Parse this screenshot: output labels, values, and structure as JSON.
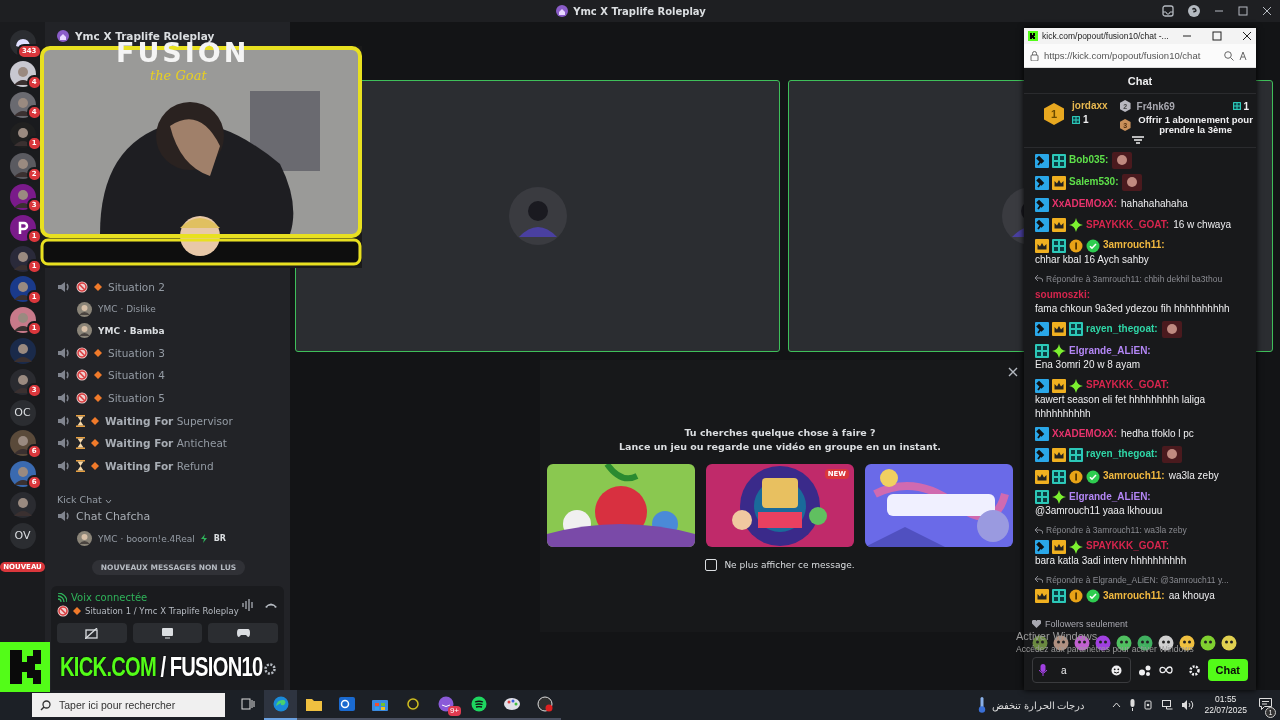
{
  "window": {
    "title": "Ymc X Traplife Roleplay"
  },
  "servers": [
    {
      "kind": "logo",
      "badge": "343"
    },
    {
      "kind": "avatar",
      "badge": "4"
    },
    {
      "kind": "avatar",
      "badge": "4"
    },
    {
      "kind": "avatar",
      "badge": "1"
    },
    {
      "kind": "avatar",
      "badge": "2"
    },
    {
      "kind": "avatar",
      "badge": "3"
    },
    {
      "kind": "letter",
      "badge": "1"
    },
    {
      "kind": "avatar",
      "badge": "1"
    },
    {
      "kind": "avatar",
      "badge": "1"
    },
    {
      "kind": "avatar",
      "badge": "1"
    },
    {
      "kind": "avatar"
    },
    {
      "kind": "avatar",
      "badge": "3"
    },
    {
      "kind": "initials",
      "label": "OC"
    },
    {
      "kind": "avatar",
      "badge": "6"
    },
    {
      "kind": "avatar",
      "badge": "6"
    },
    {
      "kind": "avatar"
    },
    {
      "kind": "initials",
      "label": "OV"
    }
  ],
  "new_pill": "NOUVEAU",
  "server_header": {
    "title": "Ymc X Traplife Roleplay"
  },
  "webcam_frame": {
    "logo": "FUSION",
    "tagline": "the Goat"
  },
  "channels": [
    {
      "kind": "voice",
      "blocked": true,
      "waiting": false,
      "name": "Situation 2",
      "members": [
        {
          "name": "YMC · Dislike",
          "speaking": false
        },
        {
          "name": "YMC · Bamba",
          "speaking": true
        }
      ]
    },
    {
      "kind": "voice",
      "blocked": true,
      "waiting": false,
      "name": "Situation 3"
    },
    {
      "kind": "voice",
      "blocked": true,
      "waiting": false,
      "name": "Situation 4"
    },
    {
      "kind": "voice",
      "blocked": true,
      "waiting": false,
      "name": "Situation 5"
    },
    {
      "kind": "voice",
      "blocked": false,
      "waiting": true,
      "name": "**Waiting For** Supervisor"
    },
    {
      "kind": "voice",
      "blocked": false,
      "waiting": true,
      "name": "**Waiting For** Anticheat"
    },
    {
      "kind": "voice",
      "blocked": false,
      "waiting": true,
      "name": "**Waiting For** Refund"
    },
    {
      "kind": "category",
      "name": "Kick Chat"
    },
    {
      "kind": "voice",
      "blocked": false,
      "waiting": false,
      "name": "Chat Chafcha",
      "members": [
        {
          "name": "YMC · booorn!e.4Real",
          "speaking": false,
          "badge": "BR"
        }
      ]
    }
  ],
  "unread_banner": "NOUVEAUX MESSAGES NON LUS",
  "voice": {
    "status": "Voix connectée",
    "channel": "Situation 1 / Ymc X Traplife Roleplay"
  },
  "stream_overlay": {
    "site": "KICK.COM",
    "separator": "/",
    "channel": "FUSION10"
  },
  "tiles": [
    {
      "speaking": true
    },
    {
      "speaking": true
    }
  ],
  "activity": {
    "title": "Tu cherches quelque chose à faire ?",
    "subtitle": "Lance un jeu ou regarde une vidéo en groupe en un instant.",
    "games": [
      {
        "kind": "picture"
      },
      {
        "kind": "picture",
        "badge": "NEW"
      },
      {
        "kind": "picture"
      }
    ],
    "dont_show": {
      "label": "Ne plus afficher ce message.",
      "checked": false
    }
  },
  "chat_window": {
    "title": "kick.com/popout/fusion10/chat -...",
    "url": "https://kick.com/popout/fusion10/chat",
    "heading": "Chat",
    "leaders": [
      {
        "rank": "1",
        "name": "jordaxx",
        "count": "1"
      },
      {
        "rank": "2",
        "name": "Fr4nk69",
        "count": "1"
      },
      {
        "rank": "3"
      }
    ],
    "gift_prompt": "Offrir 1 abonnement pour prendre la 3ème",
    "messages": [
      {
        "badges": [
          {
            "kind": "mod"
          },
          {
            "kind": "sub"
          }
        ],
        "user": "Bob035:",
        "color": "#5ee04a",
        "emote": true
      },
      {
        "badges": [
          {
            "kind": "mod"
          },
          {
            "kind": "crown"
          }
        ],
        "user": "Salem530:",
        "color": "#5ee04a",
        "emote": true
      },
      {
        "badges": [
          {
            "kind": "mod"
          }
        ],
        "user": "XxADEMOxX:",
        "color": "#e8336d",
        "text": "hahahahahaha"
      },
      {
        "badges": [
          {
            "kind": "mod"
          },
          {
            "kind": "crown"
          },
          {
            "kind": "sparkle"
          }
        ],
        "user": "SPAYKKK_GOAT:",
        "color": "#d6254d",
        "text": "16 w chwaya"
      },
      {
        "badges": [
          {
            "kind": "crown"
          },
          {
            "kind": "sub"
          },
          {
            "kind": "one"
          },
          {
            "kind": "verified"
          }
        ],
        "user": "3amrouch11:",
        "color": "#f0b840",
        "text": "chhar kbal 16 Aych sahby"
      },
      {
        "reply": "Répondre à 3amrouch11: chbih dekhil ba3thou",
        "user": "soumoszki:",
        "color": "#d6254d",
        "text": "fama chkoun 9a3ed ydezou fih hhhhhhhhhh"
      },
      {
        "badges": [
          {
            "kind": "mod"
          },
          {
            "kind": "crown"
          },
          {
            "kind": "sub"
          }
        ],
        "user": "rayen_thegoat:",
        "color": "#2fd6a7",
        "emote": true
      },
      {
        "badges": [
          {
            "kind": "sub"
          },
          {
            "kind": "sparkle"
          }
        ],
        "user": "Elgrande_ALiEN:",
        "color": "#b386f5",
        "text": "Ena 3omri 20 w 8 ayam"
      },
      {
        "badges": [
          {
            "kind": "mod"
          },
          {
            "kind": "crown"
          },
          {
            "kind": "sparkle"
          }
        ],
        "user": "SPAYKKK_GOAT:",
        "color": "#d6254d",
        "text": "kawert season eli fet hhhhhhhhh laliga hhhhhhhhhh"
      },
      {
        "badges": [
          {
            "kind": "mod"
          }
        ],
        "user": "XxADEMOxX:",
        "color": "#e8336d",
        "text": "hedha tfoklo l pc"
      },
      {
        "badges": [
          {
            "kind": "mod"
          },
          {
            "kind": "crown"
          },
          {
            "kind": "sub"
          }
        ],
        "user": "rayen_thegoat:",
        "color": "#2fd6a7",
        "emote": true
      },
      {
        "badges": [
          {
            "kind": "crown"
          },
          {
            "kind": "sub"
          },
          {
            "kind": "one"
          },
          {
            "kind": "verified"
          }
        ],
        "user": "3amrouch11:",
        "color": "#f0b840",
        "text": "wa3la zeby"
      },
      {
        "badges": [
          {
            "kind": "sub"
          },
          {
            "kind": "sparkle"
          }
        ],
        "user": "Elgrande_ALiEN:",
        "color": "#b386f5",
        "text": "@3amrouch11 yaaa lkhouuu"
      },
      {
        "reply": "Répondre à 3amrouch11: wa3la zeby",
        "badges": [
          {
            "kind": "mod"
          },
          {
            "kind": "crown"
          },
          {
            "kind": "sparkle"
          }
        ],
        "user": "SPAYKKK_GOAT:",
        "color": "#d6254d",
        "text": "bara katla 3adi interv hhhhhhhhhh"
      },
      {
        "reply": "Répondre à Elgrande_ALiEN: @3amrouch11 y...",
        "badges": [
          {
            "kind": "crown"
          },
          {
            "kind": "sub"
          },
          {
            "kind": "one"
          },
          {
            "kind": "verified"
          }
        ],
        "user": "3amrouch11:",
        "color": "#f0b840",
        "text": "aa khouya"
      }
    ],
    "mode": "Followers seulement",
    "input": {
      "value": "a"
    },
    "send": "Chat"
  },
  "watermark": {
    "title": "Activer Windows",
    "hint": "Accédez aux paramètres pour activer Windows"
  },
  "taskbar": {
    "search_placeholder": "Taper ici pour rechercher",
    "apps": [
      {
        "kind": "taskview"
      },
      {
        "kind": "edge",
        "selected": true
      },
      {
        "kind": "folder",
        "selected": false
      },
      {
        "kind": "mail",
        "selected": false
      },
      {
        "kind": "store",
        "selected": false
      },
      {
        "kind": "ring",
        "selected": false
      },
      {
        "kind": "chat",
        "selected": false,
        "badge": "9+"
      },
      {
        "kind": "music",
        "selected": false
      },
      {
        "kind": "paint",
        "selected": false
      },
      {
        "kind": "record",
        "selected": false
      }
    ],
    "weather": "درجات الحرارة تنخفض",
    "time": "01:55",
    "date": "22/07/2025",
    "notifications": "1"
  }
}
